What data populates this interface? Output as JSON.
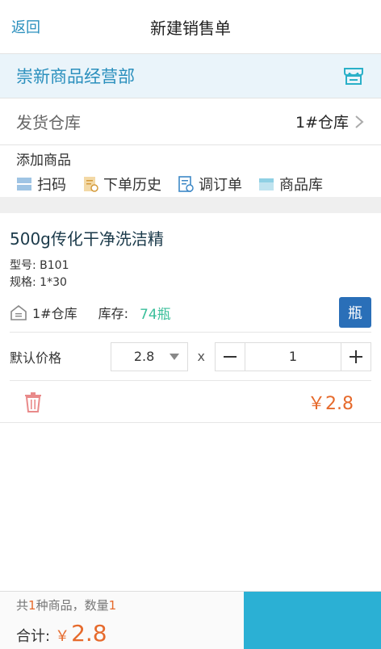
{
  "nav": {
    "back": "返回",
    "title": "新建销售单"
  },
  "shop": {
    "name": "崇新商品经营部",
    "icon": "store-icon"
  },
  "warehouse": {
    "label": "发货仓库",
    "value": "1#仓库"
  },
  "add": {
    "label": "添加商品",
    "tools": [
      {
        "label": "扫码",
        "icon": "scan-icon"
      },
      {
        "label": "下单历史",
        "icon": "history-icon"
      },
      {
        "label": "调订单",
        "icon": "order-icon"
      },
      {
        "label": "商品库",
        "icon": "product-box-icon"
      }
    ]
  },
  "item": {
    "name": "500g传化干净洗洁精",
    "model": "型号: B101",
    "spec": "规格: 1*30",
    "warehouse": "1#仓库",
    "stock_label": "库存:",
    "stock_value": "74瓶",
    "unit": "瓶",
    "price_label": "默认价格",
    "price": "2.8",
    "times": "x",
    "qty": "1",
    "subtotal": "￥2.8"
  },
  "footer": {
    "count_prefix": "共",
    "kinds": "1",
    "count_mid": "种商品，数量",
    "qty": "1",
    "total_label": "合计:",
    "currency": "￥",
    "total": "2.8"
  },
  "colors": {
    "accent": "#2a8fbd",
    "price": "#e66a2c",
    "stock": "#3bbf9b",
    "unit_button": "#2a6fb8",
    "submit": "#2bb0d4"
  }
}
